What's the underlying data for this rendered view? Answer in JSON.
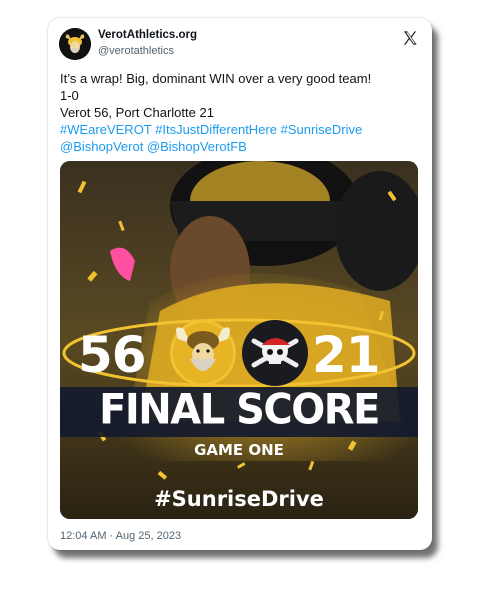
{
  "tweet": {
    "display_name": "VerotAthletics.org",
    "handle": "@verotathletics",
    "lines": [
      "It’s a wrap! Big, dominant WIN over a very good team!",
      "1-0",
      "Verot 56, Port Charlotte 21"
    ],
    "hashtags": "#WEareVEROT #ItsJustDifferentHere #SunriseDrive",
    "mentions": "@BishopVerot @BishopVerotFB",
    "timestamp": "12:04 AM · Aug 25, 2023"
  },
  "media": {
    "home_score": "56",
    "away_score": "21",
    "headline": "FINAL SCORE",
    "subheadline": "GAME ONE",
    "footer_tag": "#SunriseDrive",
    "home_logo_icon": "viking-logo-icon",
    "away_logo_icon": "pirate-skull-logo-icon"
  },
  "colors": {
    "link": "#1d9bf0",
    "accent_gold": "#f2c230",
    "banner_navy": "#141a2e"
  },
  "icons": {
    "platform": "x-logo-icon"
  }
}
